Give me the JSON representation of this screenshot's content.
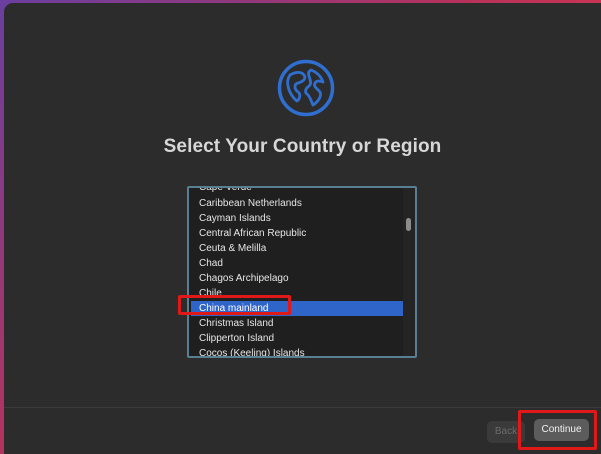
{
  "colors": {
    "accent": "#2f64c8",
    "annotation": "#e01818",
    "globe": "#2f6fd0"
  },
  "icons": {
    "globe": "globe-icon"
  },
  "setup": {
    "title": "Select Your Country or Region",
    "countries": [
      "Cape Verde",
      "Caribbean Netherlands",
      "Cayman Islands",
      "Central African Republic",
      "Ceuta & Melilla",
      "Chad",
      "Chagos Archipelago",
      "Chile",
      "China mainland",
      "Christmas Island",
      "Clipperton Island",
      "Cocos (Keeling) Islands"
    ],
    "selected_country": "China mainland",
    "buttons": {
      "back": "Back",
      "continue": "Continue"
    }
  }
}
